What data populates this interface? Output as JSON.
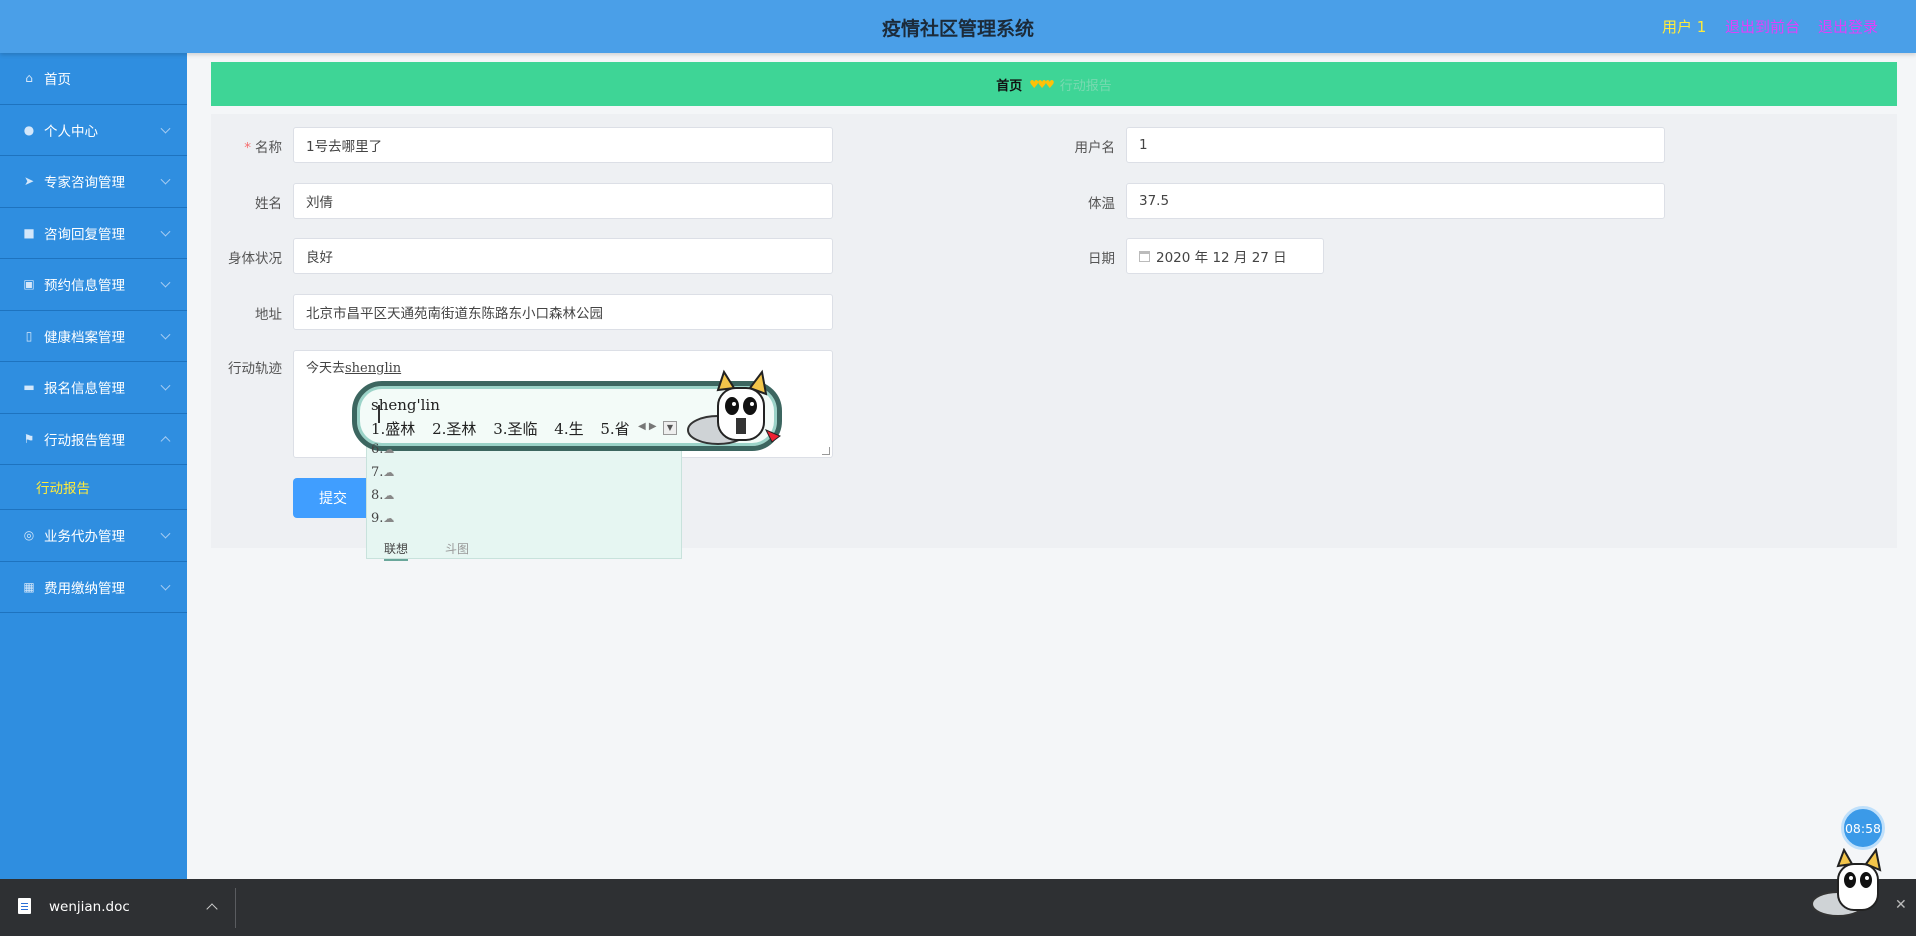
{
  "header": {
    "title": "疫情社区管理系统",
    "user": "用户 1",
    "link_front": "退出到前台",
    "link_logout": "退出登录"
  },
  "sidebar": {
    "items": [
      {
        "label": "首页",
        "icon": "home-icon"
      },
      {
        "label": "个人中心",
        "icon": "user-icon"
      },
      {
        "label": "专家咨询管理",
        "icon": "send-icon"
      },
      {
        "label": "咨询回复管理",
        "icon": "reply-icon"
      },
      {
        "label": "预约信息管理",
        "icon": "briefcase-icon"
      },
      {
        "label": "健康档案管理",
        "icon": "lock-icon"
      },
      {
        "label": "报名信息管理",
        "icon": "ticket-icon"
      },
      {
        "label": "行动报告管理",
        "icon": "flag-icon"
      },
      {
        "label": "业务代办管理",
        "icon": "lifebuoy-icon"
      },
      {
        "label": "费用缴纳管理",
        "icon": "grid-icon"
      }
    ],
    "submenu": "行动报告"
  },
  "breadcrumb": {
    "home": "首页",
    "current": "行动报告"
  },
  "form": {
    "name_label": "名称",
    "name_value": "1号去哪里了",
    "username_label": "用户名",
    "username_value": "1",
    "realname_label": "姓名",
    "realname_value": "刘倩",
    "temp_label": "体温",
    "temp_value": "37.5",
    "health_label": "身体状况",
    "health_value": "良好",
    "date_label": "日期",
    "date_value": "2020 年 12 月 27 日",
    "address_label": "地址",
    "address_value": "北京市昌平区天通苑南街道东陈路东小口森林公园",
    "track_label": "行动轨迹",
    "track_prefix": "今天去",
    "track_typed": "shenglin",
    "submit": "提交"
  },
  "ime": {
    "pinyin": "sheng'lin",
    "candidates": [
      "1.盛林",
      "2.圣林",
      "3.圣临",
      "4.生",
      "5.省"
    ],
    "rows": [
      "6.",
      "7.",
      "8.",
      "9."
    ],
    "tab_active": "联想",
    "tab_inactive": "斗图"
  },
  "clock": "08:58",
  "taskbar": {
    "file": "wenjian.doc"
  },
  "colors": {
    "header": "#4a9fe8",
    "sidebar": "#2f8ee0",
    "breadcrumb": "#3ed596",
    "button": "#409eff",
    "active_submenu": "#ffeb3b"
  }
}
